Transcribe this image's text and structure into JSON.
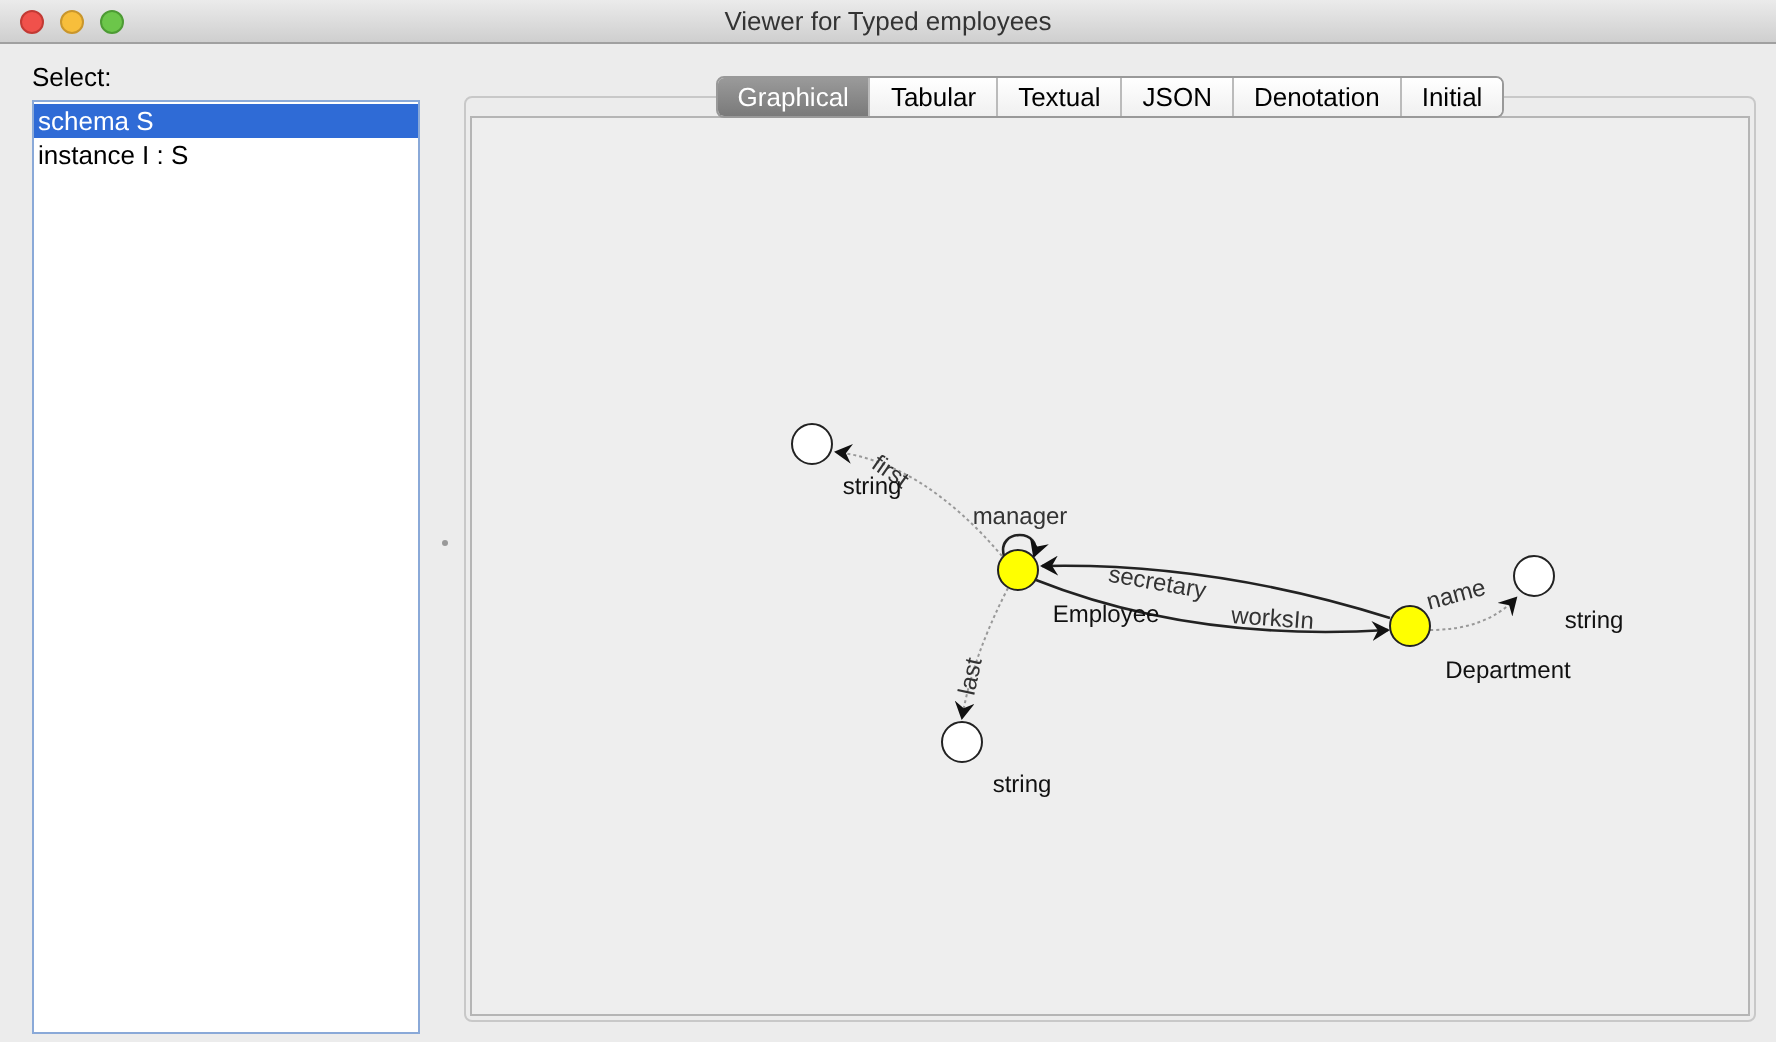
{
  "window": {
    "title": "Viewer for Typed employees"
  },
  "select_label": "Select:",
  "items": [
    {
      "label": "schema S",
      "selected": true
    },
    {
      "label": "instance I : S",
      "selected": false
    }
  ],
  "tabs": [
    {
      "label": "Graphical",
      "selected": true
    },
    {
      "label": "Tabular",
      "selected": false
    },
    {
      "label": "Textual",
      "selected": false
    },
    {
      "label": "JSON",
      "selected": false
    },
    {
      "label": "Denotation",
      "selected": false
    },
    {
      "label": "Initial",
      "selected": false
    }
  ],
  "graph": {
    "nodes": [
      {
        "label": "string",
        "kind": "attribute"
      },
      {
        "label": "Employee",
        "kind": "entity"
      },
      {
        "label": "Department",
        "kind": "entity"
      },
      {
        "label": "string",
        "kind": "attribute"
      },
      {
        "label": "string",
        "kind": "attribute"
      }
    ],
    "edges": [
      {
        "label": "first",
        "kind": "attribute"
      },
      {
        "label": "manager",
        "kind": "relation"
      },
      {
        "label": "secretary",
        "kind": "relation"
      },
      {
        "label": "worksIn",
        "kind": "relation"
      },
      {
        "label": "name",
        "kind": "attribute"
      },
      {
        "label": "last",
        "kind": "attribute"
      }
    ]
  }
}
